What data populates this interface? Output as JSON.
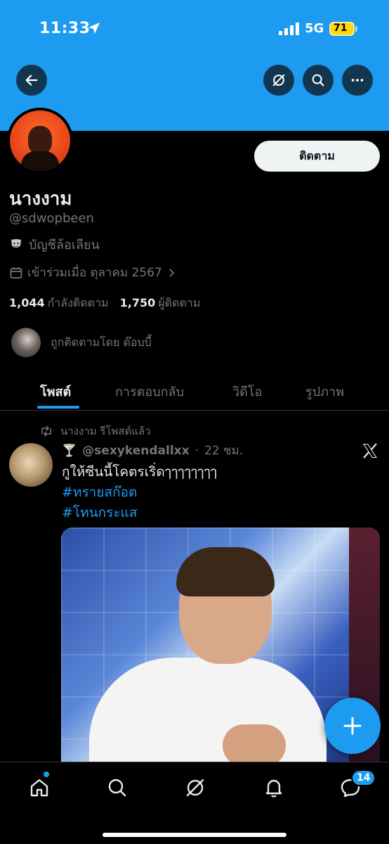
{
  "status": {
    "time": "11:33",
    "network": "5G",
    "battery": "71"
  },
  "profile": {
    "follow_label": "ติดตาม",
    "display_name": "นางงาม",
    "handle": "@sdwopbeen",
    "parody_label": "บัญชีล้อเลียน",
    "joined": "เข้าร่วมเมื่อ ตุลาคม 2567",
    "following_count": "1,044",
    "following_label": "กำลังติดตาม",
    "followers_count": "1,750",
    "followers_label": "ผู้ติดตาม",
    "followed_by": "ถูกติดตามโดย ด๊อบบี้"
  },
  "tabs": [
    {
      "label": "โพสต์",
      "active": true
    },
    {
      "label": "การตอบกลับ",
      "active": false
    },
    {
      "label": "วิดีโอ",
      "active": false
    },
    {
      "label": "รูปภาพ",
      "active": false
    }
  ],
  "post": {
    "repost_label": "นางงาม รีโพสต์แล้ว",
    "emoji": "🍸",
    "author": "@sexykendallxx",
    "separator": "·",
    "time": "22 ชม.",
    "text": "กูให้ซีนนี้โคตรเริ่ดๅๅๅๅๅๅๅๅ",
    "hashtags": [
      "#ทรายสก๊อต",
      "#โทนกระแส"
    ]
  },
  "nav": {
    "messages_badge": "14"
  },
  "icons": {
    "back": "arrow-left-icon",
    "grok": "grok-icon",
    "search": "search-icon",
    "more": "more-icon"
  },
  "colors": {
    "accent": "#1d9bf0",
    "background": "#000000",
    "muted": "#71767b"
  }
}
